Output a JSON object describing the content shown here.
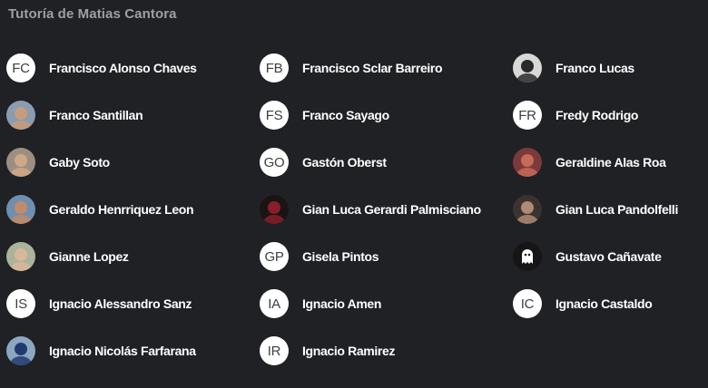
{
  "title": "Tutoría de Matias Cantora",
  "members": [
    {
      "name": "Francisco Alonso Chaves",
      "avatar": {
        "type": "initials",
        "text": "FC"
      }
    },
    {
      "name": "Francisco Sclar Barreiro",
      "avatar": {
        "type": "initials",
        "text": "FB"
      }
    },
    {
      "name": "Franco Lucas",
      "avatar": {
        "type": "photo",
        "bg": "#d8d8d8",
        "fg": "#2a2a2a"
      }
    },
    {
      "name": "Franco Santillan",
      "avatar": {
        "type": "photo",
        "bg": "#8a9cb0",
        "fg": "#c99b7d"
      }
    },
    {
      "name": "Franco Sayago",
      "avatar": {
        "type": "initials",
        "text": "FS"
      }
    },
    {
      "name": "Fredy Rodrigo",
      "avatar": {
        "type": "initials",
        "text": "FR"
      }
    },
    {
      "name": "Gaby Soto",
      "avatar": {
        "type": "photo",
        "bg": "#9c8f82",
        "fg": "#d0a888"
      }
    },
    {
      "name": "Gastón Oberst",
      "avatar": {
        "type": "initials",
        "text": "GO"
      }
    },
    {
      "name": "Geraldine Alas Roa",
      "avatar": {
        "type": "photo",
        "bg": "#7b3a3a",
        "fg": "#c76a5a"
      }
    },
    {
      "name": "Geraldo Henrriquez Leon",
      "avatar": {
        "type": "photo",
        "bg": "#6f8fb0",
        "fg": "#c28a66"
      }
    },
    {
      "name": "Gian Luca Gerardi Palmisciano",
      "avatar": {
        "type": "photo",
        "bg": "#1a1414",
        "fg": "#8a1f2a"
      }
    },
    {
      "name": "Gian Luca Pandolfelli",
      "avatar": {
        "type": "photo",
        "bg": "#3a3330",
        "fg": "#b08a74"
      }
    },
    {
      "name": "Gianne Lopez",
      "avatar": {
        "type": "photo",
        "bg": "#a9b49a",
        "fg": "#d9b79a"
      }
    },
    {
      "name": "Gisela Pintos",
      "avatar": {
        "type": "initials",
        "text": "GP"
      }
    },
    {
      "name": "Gustavo Cañavate",
      "avatar": {
        "type": "ghost",
        "bg": "#151515",
        "fg": "#ffffff"
      }
    },
    {
      "name": "Ignacio Alessandro Sanz",
      "avatar": {
        "type": "initials",
        "text": "IS"
      }
    },
    {
      "name": "Ignacio Amen",
      "avatar": {
        "type": "initials",
        "text": "IA"
      }
    },
    {
      "name": "Ignacio Castaldo",
      "avatar": {
        "type": "initials",
        "text": "IC"
      }
    },
    {
      "name": "Ignacio Nicolás Farfarana",
      "avatar": {
        "type": "photo",
        "bg": "#8ea7c0",
        "fg": "#203a70"
      }
    },
    {
      "name": "Ignacio Ramirez",
      "avatar": {
        "type": "initials",
        "text": "IR"
      }
    }
  ]
}
